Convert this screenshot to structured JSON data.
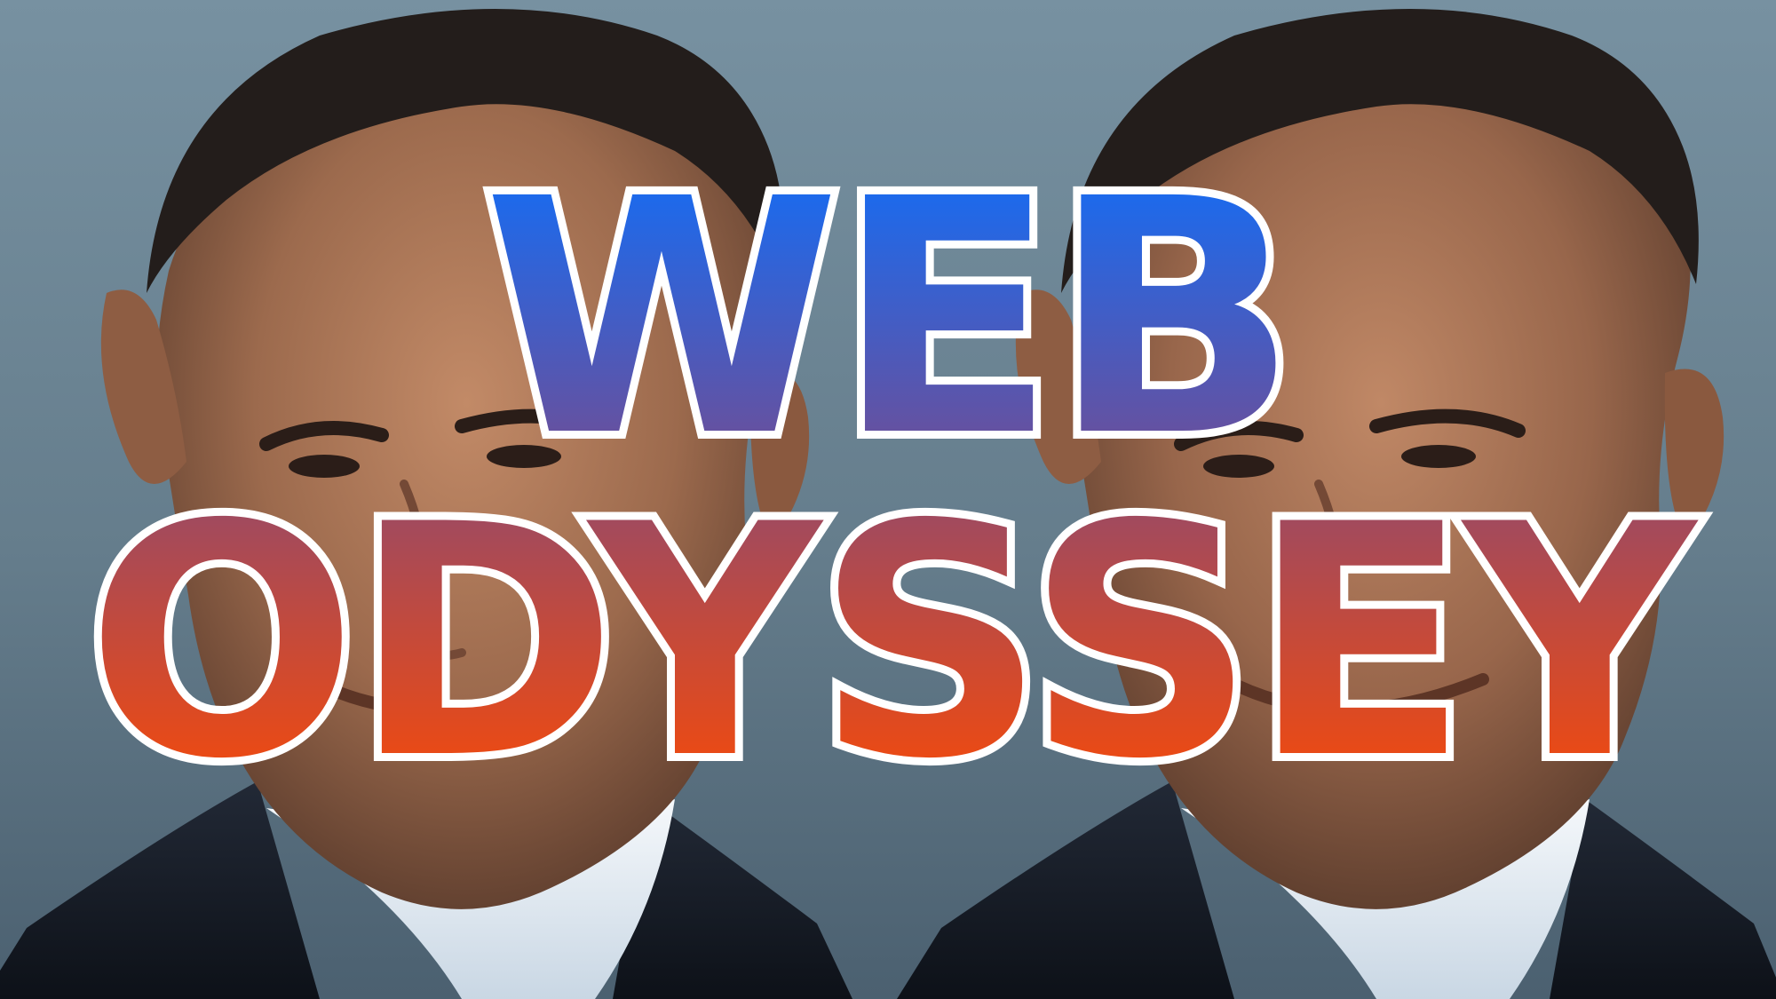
{
  "headline": {
    "line1": "WEB",
    "line2": "ODYSSEY"
  },
  "colors": {
    "background_top": "#6f8999",
    "background_bottom": "#4f6575",
    "line1_gradient_top": "#0a70ff",
    "line1_gradient_bottom": "#7b4a8a",
    "line2_gradient_top": "#8f4a70",
    "line2_gradient_bottom": "#ff4a00",
    "outline_white": "#ffffff",
    "suit_dark": "#151a24",
    "shirt_light": "#dfe8f0",
    "skin_mid": "#a26f52",
    "hair_dark": "#231d1b"
  },
  "icons": {
    "portrait_left": "portrait-photo",
    "portrait_right": "portrait-photo"
  }
}
